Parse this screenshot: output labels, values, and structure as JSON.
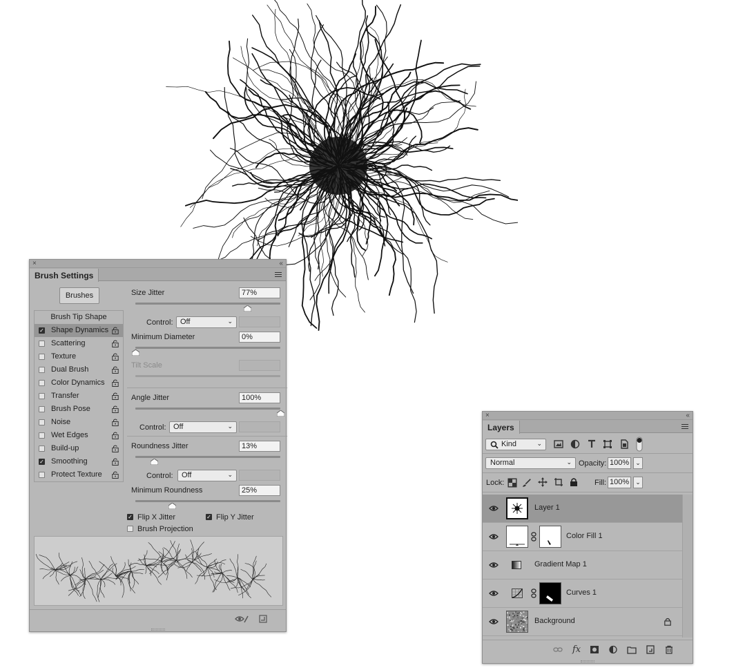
{
  "brush_settings": {
    "title": "Brush Settings",
    "brushes_button": "Brushes",
    "options": [
      {
        "label": "Brush Tip Shape",
        "header": true
      },
      {
        "label": "Shape Dynamics",
        "checked": true,
        "selected": true
      },
      {
        "label": "Scattering",
        "checked": false
      },
      {
        "label": "Texture",
        "checked": false
      },
      {
        "label": "Dual Brush",
        "checked": false
      },
      {
        "label": "Color Dynamics",
        "checked": false
      },
      {
        "label": "Transfer",
        "checked": false
      },
      {
        "label": "Brush Pose",
        "checked": false
      },
      {
        "label": "Noise",
        "checked": false
      },
      {
        "label": "Wet Edges",
        "checked": false
      },
      {
        "label": "Build-up",
        "checked": false
      },
      {
        "label": "Smoothing",
        "checked": true
      },
      {
        "label": "Protect Texture",
        "checked": false
      }
    ],
    "size_jitter": {
      "label": "Size Jitter",
      "value": "77%",
      "level": 0.77
    },
    "size_control": {
      "label": "Control:",
      "value": "Off"
    },
    "minimum_diameter": {
      "label": "Minimum Diameter",
      "value": "0%",
      "level": 0.0
    },
    "tilt_scale": {
      "label": "Tilt Scale"
    },
    "angle_jitter": {
      "label": "Angle Jitter",
      "value": "100%",
      "level": 1.0
    },
    "angle_control": {
      "label": "Control:",
      "value": "Off"
    },
    "roundness_jitter": {
      "label": "Roundness Jitter",
      "value": "13%",
      "level": 0.13
    },
    "roundness_control": {
      "label": "Control:",
      "value": "Off"
    },
    "minimum_roundness": {
      "label": "Minimum Roundness",
      "value": "25%",
      "level": 0.25
    },
    "flip_x": {
      "label": "Flip X Jitter",
      "checked": true
    },
    "flip_y": {
      "label": "Flip Y Jitter",
      "checked": true
    },
    "brush_projection": {
      "label": "Brush Projection",
      "checked": false
    }
  },
  "layers": {
    "title": "Layers",
    "filter_kind": "Kind",
    "blend_mode": "Normal",
    "opacity_label": "Opacity:",
    "opacity_value": "100%",
    "lock_label": "Lock:",
    "fill_label": "Fill:",
    "fill_value": "100%",
    "items": [
      {
        "name": "Layer 1",
        "selected": true
      },
      {
        "name": "Color Fill 1"
      },
      {
        "name": "Gradient Map 1"
      },
      {
        "name": "Curves 1"
      },
      {
        "name": "Background",
        "locked": true
      }
    ]
  },
  "icons": {
    "panel_close": "×",
    "panel_collapse": "‹‹",
    "check": "✓",
    "chevron": "⌄",
    "fx": "fx"
  }
}
